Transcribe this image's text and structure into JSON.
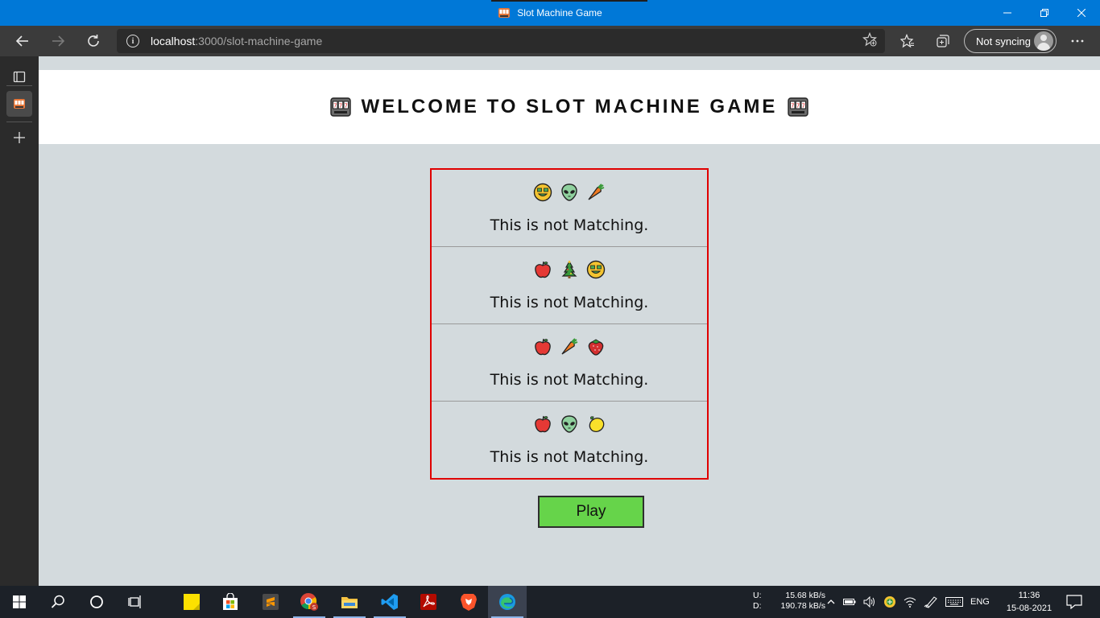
{
  "window": {
    "title": "Slot Machine Game",
    "minimize_icon": "minimize-icon",
    "restore_icon": "restore-icon",
    "close_icon": "close-icon"
  },
  "addressbar": {
    "host": "localhost",
    "path": ":3000/slot-machine-game",
    "sync_label": "Not syncing"
  },
  "page": {
    "header_title": "WELCOME TO SLOT MACHINE GAME",
    "rows": [
      {
        "emojis": [
          "money-mouth-face",
          "alien",
          "carrot"
        ],
        "message": "This is not Matching."
      },
      {
        "emojis": [
          "red-apple",
          "christmas-tree",
          "money-mouth-face"
        ],
        "message": "This is not Matching."
      },
      {
        "emojis": [
          "red-apple",
          "carrot",
          "strawberry"
        ],
        "message": "This is not Matching."
      },
      {
        "emojis": [
          "red-apple",
          "alien",
          "lemon"
        ],
        "message": "This is not Matching."
      }
    ],
    "play_label": "Play"
  },
  "taskbar": {
    "upload_label": "U:",
    "download_label": "D:",
    "upload_speed": "15.68 kB/s",
    "download_speed": "190.78 kB/s",
    "language": "ENG",
    "time": "11:36",
    "date": "15-08-2021"
  },
  "colors": {
    "titlebar": "#0078d7",
    "board_border": "#e00000",
    "play_button": "#66d44a",
    "page_background": "#d3dadd"
  }
}
